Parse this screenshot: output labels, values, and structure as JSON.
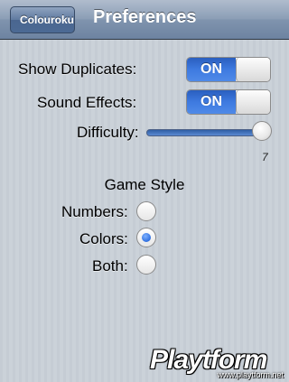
{
  "navbar": {
    "back_label": "Colouroku",
    "title": "Preferences"
  },
  "settings": {
    "show_duplicates": {
      "label": "Show Duplicates:",
      "state": "ON"
    },
    "sound_effects": {
      "label": "Sound Effects:",
      "state": "ON"
    },
    "difficulty": {
      "label": "Difficulty:",
      "value": "7",
      "level": 7
    }
  },
  "game_style": {
    "title": "Game Style",
    "options": [
      {
        "label": "Numbers:",
        "selected": false
      },
      {
        "label": "Colors:",
        "selected": true
      },
      {
        "label": "Both:",
        "selected": false
      }
    ]
  },
  "watermark": {
    "brand": "Playtform",
    "url": "www.playtform.net",
    "colors": {
      "accent": "#f5a623"
    }
  },
  "colors": {
    "background": "#c5ccd4",
    "navbar": "#6d83a1",
    "toggle_on": "#3e7ae0"
  }
}
